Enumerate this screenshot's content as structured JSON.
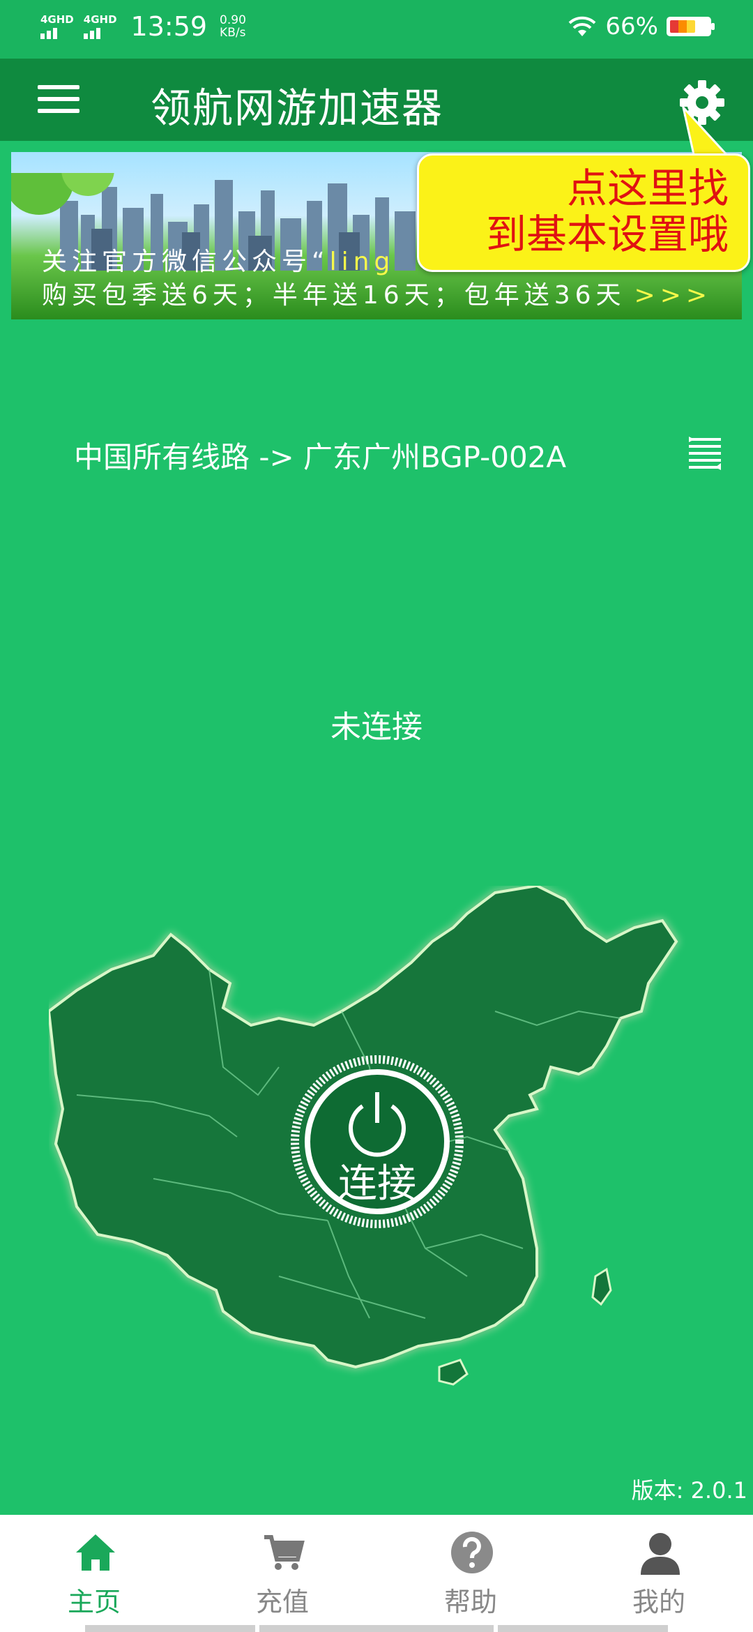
{
  "status_bar": {
    "signal1": "4GHD",
    "signal2": "4GHD",
    "time": "13:59",
    "speed_value": "0.90",
    "speed_unit": "KB/s",
    "battery": "66%",
    "battery_level": 0.66
  },
  "app_bar": {
    "title": "领航网游加速器",
    "menu_icon": "hamburger-menu-icon",
    "settings_icon": "gear-icon"
  },
  "banner": {
    "line1_prefix": "关注官方微信公众号“",
    "line1_highlight": "ling",
    "line2": "购买包季送6天；半年送16天；包年送36天",
    "chevrons": ">>>"
  },
  "tooltip": {
    "line1": "点这里找",
    "line2": "到基本设置哦"
  },
  "route": {
    "text": "中国所有线路 -> 广东广州BGP-002A",
    "list_icon": "route-list-icon"
  },
  "connection_status": "未连接",
  "connect_button": {
    "label": "连接",
    "icon": "power-icon"
  },
  "version": "版本: 2.0.1",
  "bottom_nav": [
    {
      "label": "主页",
      "icon": "home-icon",
      "active": true
    },
    {
      "label": "充值",
      "icon": "cart-icon",
      "active": false
    },
    {
      "label": "帮助",
      "icon": "help-icon",
      "active": false
    },
    {
      "label": "我的",
      "icon": "user-icon",
      "active": false
    }
  ],
  "colors": {
    "background": "#1ec16a",
    "app_bar": "#0f8a3f",
    "map": "#13763a",
    "tooltip_bg": "#fbf218",
    "tooltip_text": "#e01212",
    "nav_active": "#1aa85a"
  }
}
